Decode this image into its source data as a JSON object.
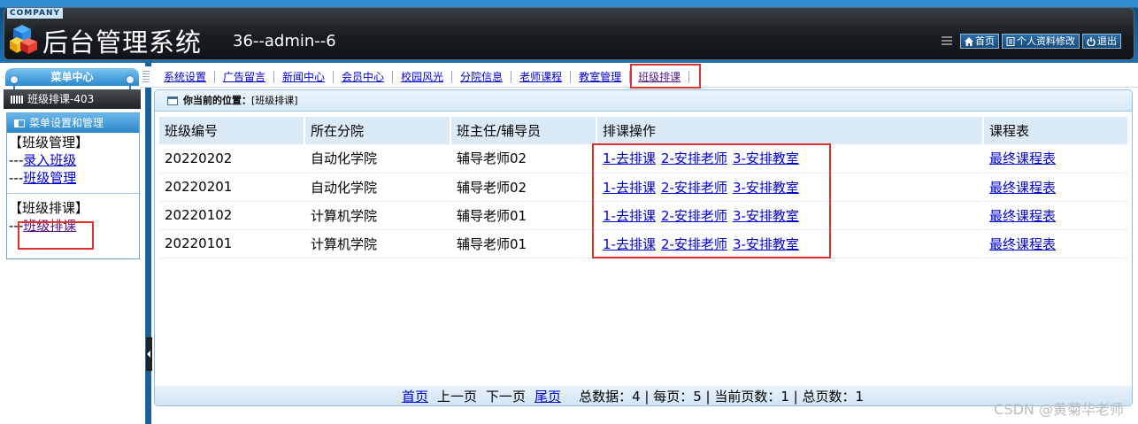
{
  "header": {
    "company": "COMPANY",
    "title": "后台管理系统",
    "user_info": "36--admin--6",
    "actions": [
      {
        "label": "首页",
        "icon": "home-icon"
      },
      {
        "label": "个人资料修改",
        "icon": "profile-icon"
      },
      {
        "label": "退出",
        "icon": "power-icon"
      }
    ]
  },
  "sidebar": {
    "menu_center": "菜单中心",
    "current_item": "班级排课-403",
    "box_title": "菜单设置和管理",
    "groups": [
      {
        "title": "【班级管理】",
        "items": [
          {
            "prefix": "---",
            "label": "录入班级"
          },
          {
            "prefix": "---",
            "label": "班级管理"
          }
        ]
      },
      {
        "title": "【班级排课】",
        "items": [
          {
            "prefix": "---",
            "label": "班级排课"
          }
        ]
      }
    ]
  },
  "nav": {
    "tabs": [
      "系统设置",
      "广告留言",
      "新闻中心",
      "会员中心",
      "校园风光",
      "分院信息",
      "老师课程",
      "教室管理",
      "班级排课"
    ],
    "active_index": 8
  },
  "location": {
    "prefix": "你当前的位置：",
    "value": "[班级排课]"
  },
  "table": {
    "headers": [
      "班级编号",
      "所在分院",
      "班主任/辅导员",
      "排课操作",
      "课程表"
    ],
    "rows": [
      {
        "id": "20220202",
        "college": "自动化学院",
        "teacher": "辅导老师02",
        "ops": [
          "1-去排课",
          "2-安排老师",
          "3-安排教室"
        ],
        "schedule": "最终课程表"
      },
      {
        "id": "20220201",
        "college": "自动化学院",
        "teacher": "辅导老师02",
        "ops": [
          "1-去排课",
          "2-安排老师",
          "3-安排教室"
        ],
        "schedule": "最终课程表"
      },
      {
        "id": "20220102",
        "college": "计算机学院",
        "teacher": "辅导老师01",
        "ops": [
          "1-去排课",
          "2-安排老师",
          "3-安排教室"
        ],
        "schedule": "最终课程表"
      },
      {
        "id": "20220101",
        "college": "计算机学院",
        "teacher": "辅导老师01",
        "ops": [
          "1-去排课",
          "2-安排老师",
          "3-安排教室"
        ],
        "schedule": "最终课程表"
      }
    ]
  },
  "pager": {
    "first": "首页",
    "prev": "上一页",
    "next": "下一页",
    "last": "尾页",
    "stats": "总数据：4 | 每页：5 | 当前页数：1 | 总页数：1"
  },
  "watermark": "CSDN @黄菊华老师",
  "colors": {
    "link": "#0000cc",
    "visited": "#551a8b",
    "highlight": "#e03030",
    "header_dark": "#181c20",
    "accent_blue": "#2d86c9"
  }
}
